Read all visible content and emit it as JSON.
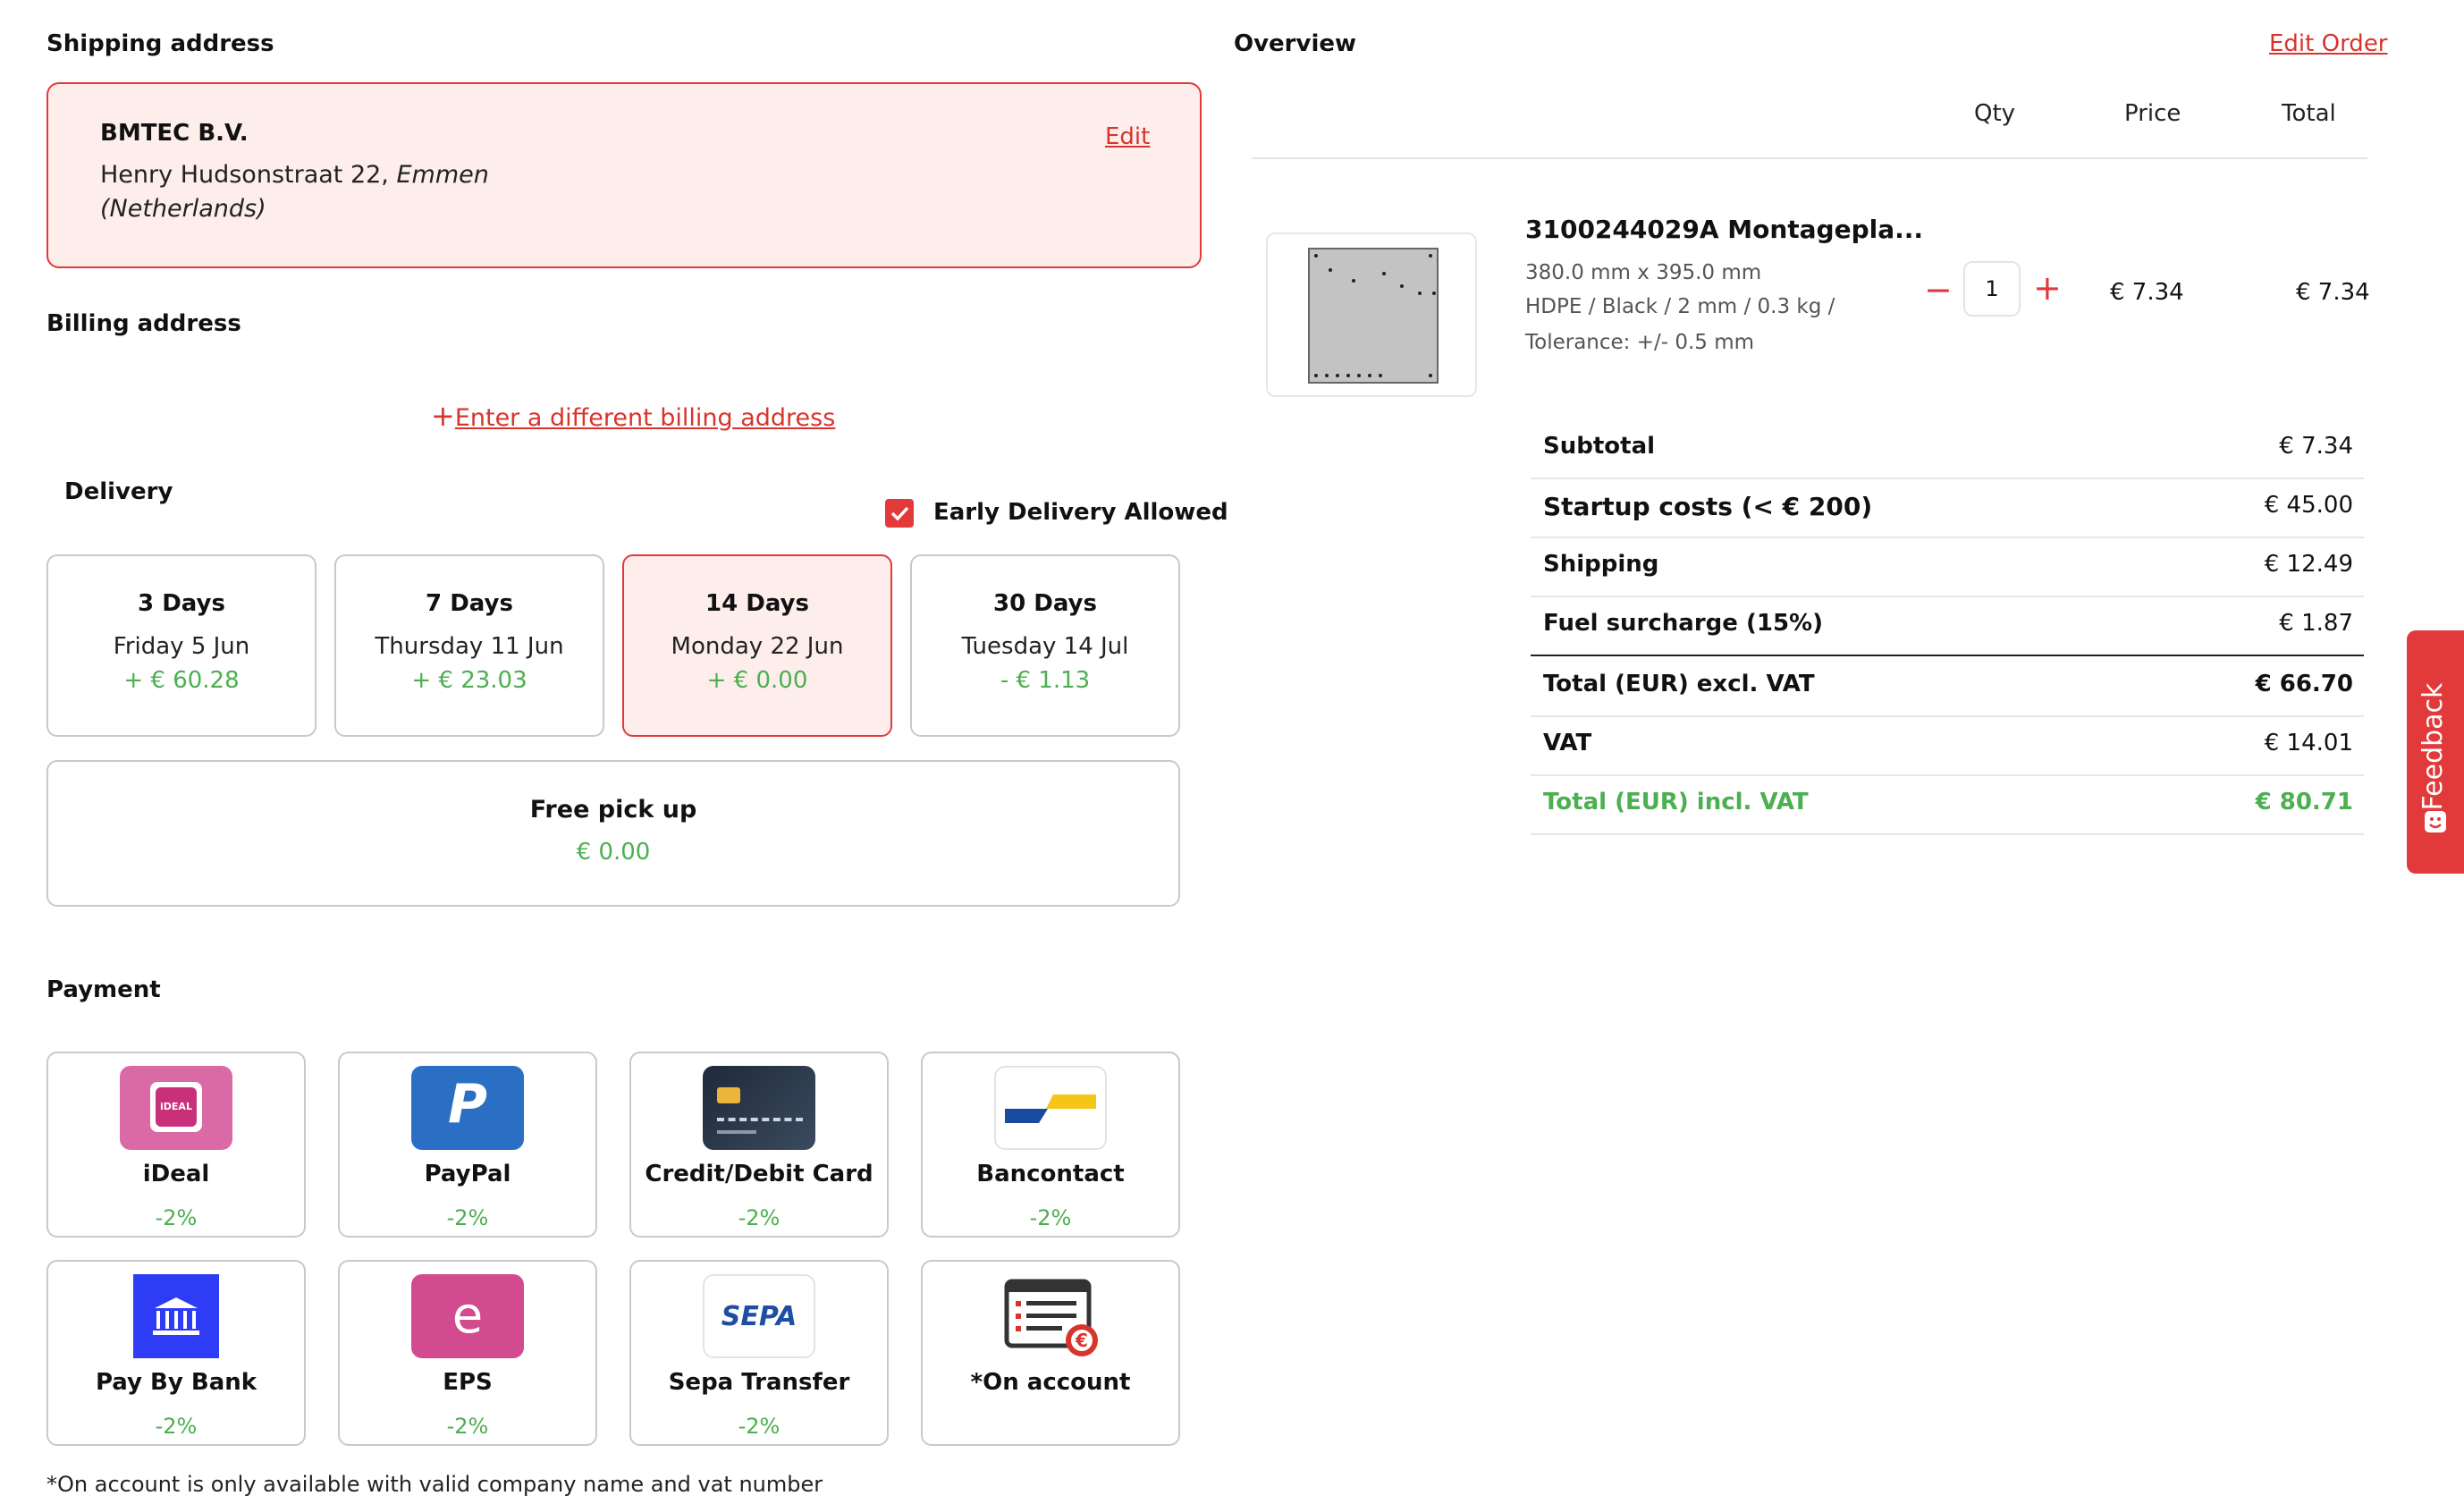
{
  "shipping": {
    "heading": "Shipping address",
    "company": "BMTEC B.V.",
    "line1": "Henry Hudsonstraat 22,",
    "city": "Emmen",
    "country": "(Netherlands)",
    "edit_label": "Edit"
  },
  "billing": {
    "heading": "Billing address",
    "plus": "+",
    "link_label": "Enter a different billing address"
  },
  "delivery": {
    "heading": "Delivery",
    "early_label": "Early Delivery Allowed",
    "early_checked": true,
    "options": [
      {
        "title": "3 Days",
        "date": "Friday 5 Jun",
        "price": "+ € 60.28"
      },
      {
        "title": "7 Days",
        "date": "Thursday 11 Jun",
        "price": "+ € 23.03"
      },
      {
        "title": "14 Days",
        "date": "Monday 22 Jun",
        "price": "+ € 0.00",
        "selected": true
      },
      {
        "title": "30 Days",
        "date": "Tuesday 14 Jul",
        "price": "- € 1.13"
      }
    ],
    "pickup": {
      "title": "Free pick up",
      "price": "€ 0.00"
    }
  },
  "payment": {
    "heading": "Payment",
    "methods": [
      {
        "name": "iDeal",
        "discount": "-2%",
        "icon": "ideal-icon",
        "icon_text": "iDEAL"
      },
      {
        "name": "PayPal",
        "discount": "-2%",
        "icon": "paypal-icon",
        "icon_text": "P"
      },
      {
        "name": "Credit/Debit Card",
        "discount": "-2%",
        "icon": "credit-card-icon"
      },
      {
        "name": "Bancontact",
        "discount": "-2%",
        "icon": "bancontact-icon"
      },
      {
        "name": "Pay By Bank",
        "discount": "-2%",
        "icon": "bank-icon"
      },
      {
        "name": "EPS",
        "discount": "-2%",
        "icon": "eps-icon",
        "icon_text": "e"
      },
      {
        "name": "Sepa Transfer",
        "discount": "-2%",
        "icon": "sepa-icon",
        "icon_text": "SEPA"
      },
      {
        "name": "*On account",
        "discount": "",
        "icon": "invoice-icon",
        "icon_text": "€"
      }
    ],
    "footnote": "*On account is only available with valid company name and vat number"
  },
  "overview": {
    "heading": "Overview",
    "edit_order": "Edit Order",
    "col_qty": "Qty",
    "col_price": "Price",
    "col_total": "Total",
    "item": {
      "name": "3100244029A Montagepla...",
      "dims": "380.0 mm x 395.0 mm",
      "spec": "HDPE / Black / 2 mm / 0.3 kg /",
      "tolerance": "Tolerance: +/- 0.5 mm",
      "qty": "1",
      "minus": "−",
      "plus": "+",
      "price": "€ 7.34",
      "total": "€ 7.34"
    },
    "summary": [
      {
        "label": "Subtotal",
        "value": "€ 7.34"
      },
      {
        "label": "Startup costs (< € 200)",
        "value": "€ 45.00"
      },
      {
        "label": "Shipping",
        "value": "€ 12.49"
      },
      {
        "label": "Fuel surcharge (15%)",
        "value": "€ 1.87"
      },
      {
        "label": "Total (EUR) excl. VAT",
        "value": "€ 66.70"
      },
      {
        "label": "VAT",
        "value": "€ 14.01"
      },
      {
        "label": "Total (EUR) incl. VAT",
        "value": "€ 80.71"
      }
    ]
  },
  "feedback": {
    "label": "Feedback"
  },
  "colors": {
    "accent": "#e2393a",
    "green": "#4caf50",
    "selected_bg": "#fdeeec"
  }
}
